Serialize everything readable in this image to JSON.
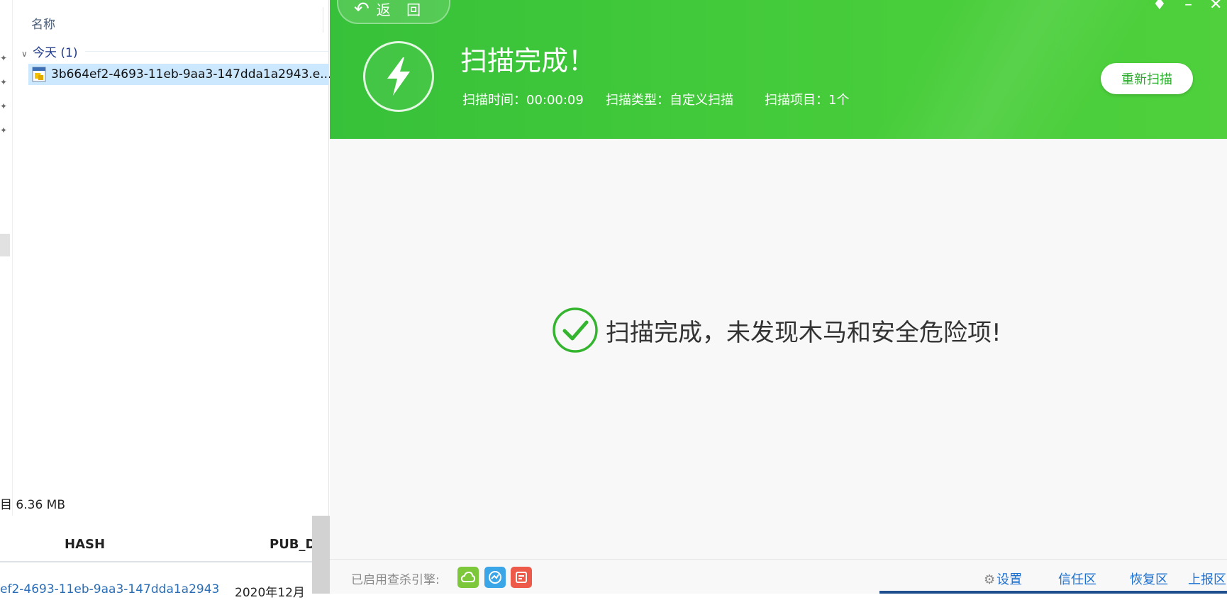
{
  "explorer": {
    "column_header": "名称",
    "group_label": "今天 (1)",
    "file_name": "3b664ef2-4693-11eb-9aa3-147dda1a2943.e...",
    "status_text": "目  6.36 MB"
  },
  "webtable": {
    "headers": [
      "HASH",
      "PUB_D"
    ],
    "row": [
      "ef2-4693-11eb-9aa3-147dda1a2943",
      "2020年12月"
    ]
  },
  "scanner": {
    "back_label": "返 回",
    "title": "扫描完成！",
    "scan_time": "扫描时间：00:00:09",
    "scan_type": "扫描类型：自定义扫描",
    "scan_items": "扫描项目：1个",
    "rescan_button": "重新扫描",
    "result_message": "扫描完成，未发现木马和安全危险项!",
    "footer": {
      "engines_label": "已启用查杀引擎:",
      "settings": "设置",
      "trust_zone": "信任区",
      "restore_zone": "恢复区",
      "report_zone": "上报区"
    },
    "colors": {
      "banner": "#3fc83b",
      "accent_green": "#2bab2b",
      "link_blue": "#1a6fd0"
    }
  }
}
